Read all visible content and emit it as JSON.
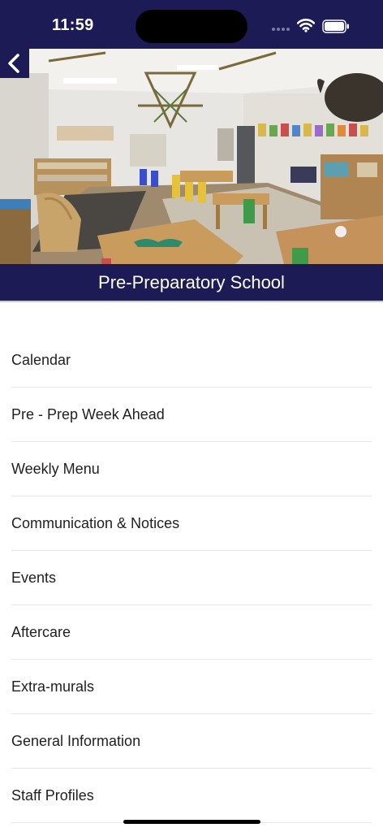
{
  "status_bar": {
    "time": "11:59",
    "icons": [
      "signal-icon",
      "wifi-icon",
      "battery-icon"
    ]
  },
  "header": {
    "back_icon": "chevron-left-icon",
    "title": "Pre-Preparatory School",
    "brand_color": "#1d1b55"
  },
  "menu": {
    "items": [
      {
        "label": "Calendar"
      },
      {
        "label": "Pre - Prep Week Ahead"
      },
      {
        "label": "Weekly Menu"
      },
      {
        "label": "Communication & Notices"
      },
      {
        "label": "Events"
      },
      {
        "label": "Aftercare"
      },
      {
        "label": "Extra-murals"
      },
      {
        "label": "General Information"
      },
      {
        "label": "Staff Profiles"
      }
    ]
  }
}
